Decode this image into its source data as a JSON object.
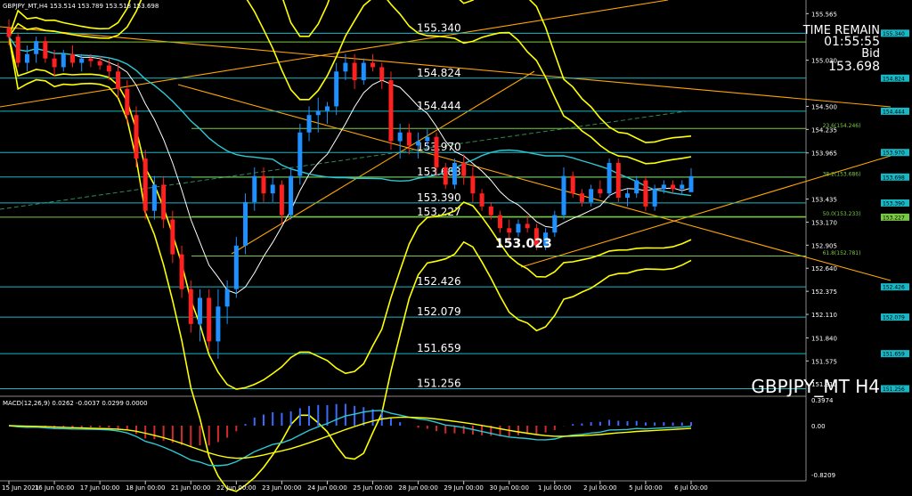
{
  "header": {
    "ohlc": "GBPJPY_MT,H4  153.514 153.789 153.518 153.698"
  },
  "overlay": {
    "time_remain_label": "TIME REMAIN",
    "time_remain_value": "01:55:55",
    "bid_label": "Bid",
    "bid_value": "153.698",
    "symbol": "GBPJPY_MT H4",
    "low_marker": "153.023"
  },
  "macd": {
    "label": "MACD(12,26,9) 0.0262 -0.0037 0.0299 0.0000",
    "ticks": [
      "0.3974",
      "0.00",
      "-0.8209"
    ]
  },
  "chart_data": {
    "type": "candlestick",
    "symbol": "GBPJPY_MT",
    "timeframe": "H4",
    "ylim": [
      151.2,
      155.64
    ],
    "y_ticks": [
      "155.565",
      "155.030",
      "154.500",
      "154.235",
      "153.965",
      "153.435",
      "153.170",
      "152.905",
      "152.640",
      "152.375",
      "152.110",
      "151.840",
      "151.575",
      "151.310"
    ],
    "x_ticks": [
      "15 Jun 2021",
      "16 Jun 00:00",
      "17 Jun 00:00",
      "18 Jun 00:00",
      "21 Jun 00:00",
      "22 Jun 00:00",
      "23 Jun 00:00",
      "24 Jun 00:00",
      "25 Jun 00:00",
      "28 Jun 00:00",
      "29 Jun 00:00",
      "30 Jun 00:00",
      "1 Jul 00:00",
      "2 Jul 00:00",
      "5 Jul 00:00",
      "6 Jul 00:00"
    ],
    "levels": [
      {
        "value": 155.34,
        "label": "155.340",
        "tag": "155.340",
        "color": "#17b8c6"
      },
      {
        "value": 155.24,
        "label": "",
        "tag": "",
        "color": "#7ac943"
      },
      {
        "value": 154.824,
        "label": "154.824",
        "tag": "154.824",
        "color": "#17b8c6"
      },
      {
        "value": 154.444,
        "label": "154.444",
        "tag": "154.444",
        "color": "#17b8c6"
      },
      {
        "value": 153.97,
        "label": "153.970",
        "tag": "153.970",
        "color": "#17b8c6"
      },
      {
        "value": 153.688,
        "label": "153.688",
        "tag": "153.698",
        "color": "#17b8c6"
      },
      {
        "value": 153.39,
        "label": "153.390",
        "tag": "153.390",
        "color": "#17b8c6"
      },
      {
        "value": 153.227,
        "label": "153.227",
        "tag": "153.227",
        "color": "#7ac943"
      },
      {
        "value": 152.426,
        "label": "152.426",
        "tag": "152.426",
        "color": "#17b8c6"
      },
      {
        "value": 152.079,
        "label": "152.079",
        "tag": "152.079",
        "color": "#17b8c6"
      },
      {
        "value": 151.659,
        "label": "151.659",
        "tag": "151.659",
        "color": "#17b8c6"
      },
      {
        "value": 151.256,
        "label": "151.256",
        "tag": "151.256",
        "color": "#17b8c6"
      }
    ],
    "fibo": [
      {
        "value": 154.246,
        "label": "23.6(154.246)"
      },
      {
        "value": 153.686,
        "label": "38.2(153.686)"
      },
      {
        "value": 153.233,
        "label": "50.0(153.233)"
      },
      {
        "value": 152.781,
        "label": "61.8(152.781)"
      }
    ],
    "candles": [
      [
        155.4,
        155.5,
        155.2,
        155.3
      ],
      [
        155.3,
        155.35,
        154.95,
        155.0
      ],
      [
        155.0,
        155.2,
        154.9,
        155.1
      ],
      [
        155.1,
        155.3,
        155.0,
        155.25
      ],
      [
        155.25,
        155.3,
        155.0,
        155.05
      ],
      [
        155.05,
        155.15,
        154.85,
        154.95
      ],
      [
        154.95,
        155.15,
        154.9,
        155.1
      ],
      [
        155.1,
        155.2,
        154.95,
        155.0
      ],
      [
        155.0,
        155.1,
        154.9,
        155.05
      ],
      [
        155.05,
        155.1,
        154.95,
        155.02
      ],
      [
        155.02,
        155.08,
        154.92,
        154.97
      ],
      [
        154.97,
        155.05,
        154.8,
        154.9
      ],
      [
        154.9,
        155.0,
        154.6,
        154.7
      ],
      [
        154.7,
        154.8,
        154.3,
        154.4
      ],
      [
        154.4,
        154.5,
        153.8,
        153.9
      ],
      [
        153.9,
        154.0,
        153.2,
        153.3
      ],
      [
        153.3,
        153.7,
        153.2,
        153.6
      ],
      [
        153.6,
        153.7,
        153.1,
        153.2
      ],
      [
        153.2,
        153.3,
        152.7,
        152.8
      ],
      [
        152.8,
        152.9,
        152.3,
        152.4
      ],
      [
        152.4,
        152.5,
        151.9,
        152.0
      ],
      [
        152.0,
        152.4,
        151.8,
        152.3
      ],
      [
        152.3,
        152.4,
        151.7,
        151.8
      ],
      [
        151.8,
        152.4,
        151.6,
        152.2
      ],
      [
        152.2,
        152.5,
        152.0,
        152.4
      ],
      [
        152.4,
        153.0,
        152.3,
        152.9
      ],
      [
        152.9,
        153.5,
        152.8,
        153.4
      ],
      [
        153.4,
        153.8,
        153.3,
        153.7
      ],
      [
        153.7,
        153.8,
        153.4,
        153.5
      ],
      [
        153.5,
        153.7,
        153.4,
        153.6
      ],
      [
        153.6,
        153.65,
        153.15,
        153.25
      ],
      [
        153.25,
        153.8,
        153.2,
        153.7
      ],
      [
        153.7,
        154.3,
        153.6,
        154.2
      ],
      [
        154.2,
        154.5,
        154.1,
        154.4
      ],
      [
        154.4,
        154.6,
        154.2,
        154.45
      ],
      [
        154.45,
        154.55,
        154.3,
        154.5
      ],
      [
        154.5,
        155.0,
        154.4,
        154.9
      ],
      [
        154.9,
        155.1,
        154.8,
        155.0
      ],
      [
        155.0,
        155.1,
        154.7,
        154.8
      ],
      [
        154.8,
        155.05,
        154.75,
        155.0
      ],
      [
        155.0,
        155.1,
        154.9,
        154.95
      ],
      [
        154.95,
        155.0,
        154.7,
        154.8
      ],
      [
        154.8,
        154.9,
        154.0,
        154.1
      ],
      [
        154.1,
        154.3,
        153.9,
        154.2
      ],
      [
        154.2,
        154.3,
        153.95,
        154.05
      ],
      [
        154.05,
        154.2,
        153.9,
        154.1
      ],
      [
        154.1,
        154.25,
        154.0,
        154.15
      ],
      [
        154.15,
        154.2,
        153.7,
        153.8
      ],
      [
        153.8,
        153.85,
        153.55,
        153.6
      ],
      [
        153.6,
        153.9,
        153.55,
        153.85
      ],
      [
        153.85,
        153.95,
        153.6,
        153.7
      ],
      [
        153.7,
        153.8,
        153.4,
        153.5
      ],
      [
        153.5,
        153.55,
        153.3,
        153.35
      ],
      [
        153.35,
        153.4,
        153.2,
        153.25
      ],
      [
        153.25,
        153.3,
        153.05,
        153.1
      ],
      [
        153.1,
        153.2,
        152.95,
        153.05
      ],
      [
        153.05,
        153.2,
        153.0,
        153.15
      ],
      [
        153.15,
        153.25,
        153.05,
        153.1
      ],
      [
        153.1,
        153.15,
        152.85,
        152.9
      ],
      [
        152.9,
        153.1,
        152.85,
        153.05
      ],
      [
        153.05,
        153.3,
        153.0,
        153.25
      ],
      [
        153.25,
        153.8,
        153.2,
        153.7
      ],
      [
        153.7,
        153.75,
        153.45,
        153.5
      ],
      [
        153.5,
        153.55,
        153.35,
        153.4
      ],
      [
        153.4,
        153.6,
        153.35,
        153.55
      ],
      [
        153.55,
        153.65,
        153.45,
        153.5
      ],
      [
        153.5,
        153.9,
        153.45,
        153.85
      ],
      [
        153.85,
        153.9,
        153.4,
        153.45
      ],
      [
        153.45,
        153.55,
        153.35,
        153.5
      ],
      [
        153.5,
        153.7,
        153.45,
        153.65
      ],
      [
        153.65,
        153.7,
        153.3,
        153.35
      ],
      [
        153.35,
        153.6,
        153.3,
        153.55
      ],
      [
        153.55,
        153.65,
        153.5,
        153.6
      ],
      [
        153.6,
        153.65,
        153.5,
        153.55
      ],
      [
        153.55,
        153.65,
        153.48,
        153.6
      ],
      [
        153.514,
        153.789,
        153.518,
        153.698
      ]
    ],
    "moving_averages": [
      {
        "color": "#ffffff",
        "type": "fast"
      },
      {
        "color": "#2ec7d4",
        "type": "slow"
      }
    ],
    "bollinger_color": "#ffff00",
    "trendline_color": "#ffa500"
  }
}
